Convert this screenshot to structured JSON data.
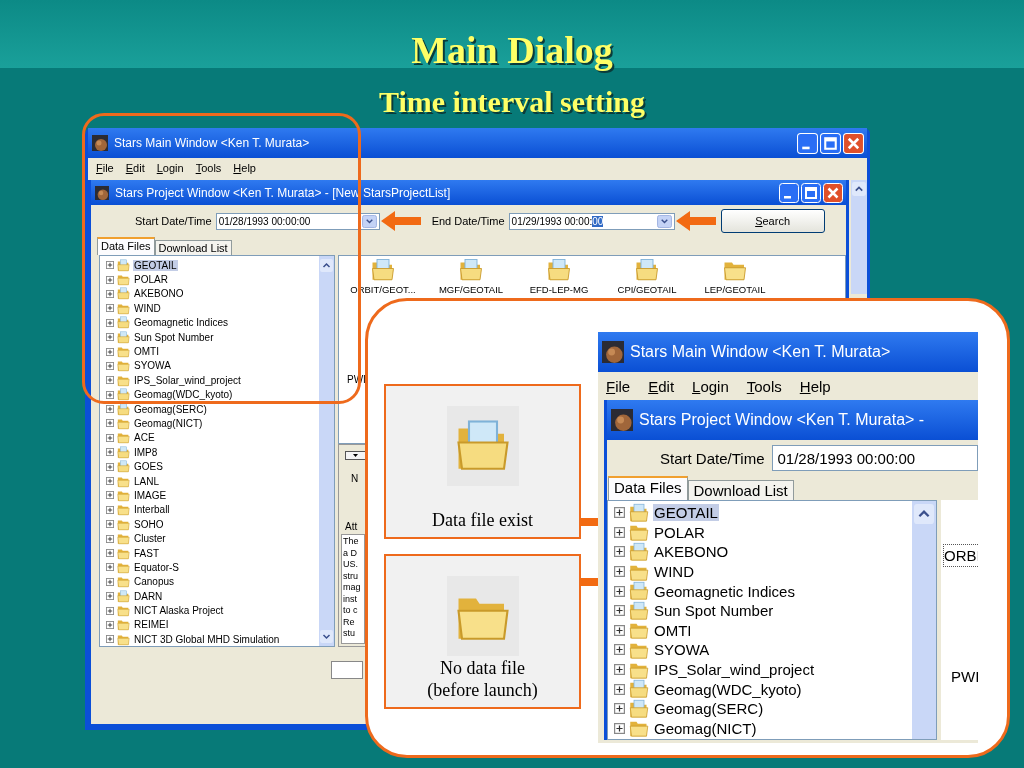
{
  "slide": {
    "title": "Main Dialog",
    "subtitle": "Time interval setting"
  },
  "main_window": {
    "title": "Stars Main Window <Ken T. Murata>",
    "menu": [
      "File",
      "Edit",
      "Login",
      "Tools",
      "Help"
    ],
    "project_window": {
      "title": "Stars Project Window <Ken T. Murata> - [New StarsProjectList]",
      "start_label": "Start Date/Time",
      "start_value": "01/28/1993 00:00:00",
      "end_label": "End Date/Time",
      "end_value": "01/29/1993 00:00:",
      "end_selection": "00",
      "search_button": "Search",
      "tabs": [
        {
          "label": "Data Files",
          "selected": true
        },
        {
          "label": "Download List",
          "selected": false
        }
      ],
      "tree": [
        {
          "name": "GEOTAIL",
          "data": true,
          "selected": true
        },
        {
          "name": "POLAR",
          "data": false,
          "selected": false
        },
        {
          "name": "AKEBONO",
          "data": true,
          "selected": false
        },
        {
          "name": "WIND",
          "data": false,
          "selected": false
        },
        {
          "name": "Geomagnetic Indices",
          "data": true,
          "selected": false
        },
        {
          "name": "Sun Spot Number",
          "data": true,
          "selected": false
        },
        {
          "name": "OMTI",
          "data": false,
          "selected": false
        },
        {
          "name": "SYOWA",
          "data": false,
          "selected": false
        },
        {
          "name": "IPS_Solar_wind_project",
          "data": false,
          "selected": false
        },
        {
          "name": "Geomag(WDC_kyoto)",
          "data": true,
          "selected": false
        },
        {
          "name": "Geomag(SERC)",
          "data": true,
          "selected": false
        },
        {
          "name": "Geomag(NICT)",
          "data": false,
          "selected": false
        },
        {
          "name": "ACE",
          "data": false,
          "selected": false
        },
        {
          "name": "IMP8",
          "data": true,
          "selected": false
        },
        {
          "name": "GOES",
          "data": true,
          "selected": false
        },
        {
          "name": "LANL",
          "data": false,
          "selected": false
        },
        {
          "name": "IMAGE",
          "data": false,
          "selected": false
        },
        {
          "name": "Interball",
          "data": false,
          "selected": false
        },
        {
          "name": "SOHO",
          "data": false,
          "selected": false
        },
        {
          "name": "Cluster",
          "data": false,
          "selected": false
        },
        {
          "name": "FAST",
          "data": false,
          "selected": false
        },
        {
          "name": "Equator-S",
          "data": false,
          "selected": false
        },
        {
          "name": "Canopus",
          "data": false,
          "selected": false
        },
        {
          "name": "DARN",
          "data": true,
          "selected": false
        },
        {
          "name": "NICT Alaska Project",
          "data": false,
          "selected": false
        },
        {
          "name": "REIMEI",
          "data": false,
          "selected": false
        },
        {
          "name": "NICT 3D Global MHD Simulation",
          "data": false,
          "selected": false
        }
      ],
      "files": [
        {
          "name": "ORBIT/GEOT...",
          "data": true
        },
        {
          "name": "MGF/GEOTAIL",
          "data": true
        },
        {
          "name": "EFD-LEP-MG",
          "data": true
        },
        {
          "name": "CPI/GEOTAIL",
          "data": true
        },
        {
          "name": "LEP/GEOTAIL",
          "data": false
        }
      ],
      "second_row_file": "PWI",
      "detail": {
        "name_fragment": "N",
        "attributes_label": "Att",
        "text_lines": [
          "The",
          "a D",
          "US.",
          "stru",
          "mag",
          "inst",
          "to c",
          "Re",
          "stu"
        ]
      }
    }
  },
  "callout": {
    "legend": [
      {
        "kind": "data",
        "lines": [
          "Data file exist"
        ]
      },
      {
        "kind": "empty",
        "lines": [
          "No data file",
          "(before launch)"
        ]
      }
    ],
    "zoom": {
      "main_title": "Stars Main Window <Ken T. Murata>",
      "menu": [
        "File",
        "Edit",
        "Login",
        "Tools",
        "Help"
      ],
      "project_title": "Stars Project Window <Ken T. Murata> -",
      "start_label": "Start Date/Time",
      "start_value": "01/28/1993 00:00:00",
      "tabs": [
        {
          "label": "Data Files",
          "selected": true
        },
        {
          "label": "Download List",
          "selected": false
        }
      ],
      "tree": [
        {
          "name": "GEOTAIL",
          "data": true,
          "selected": true
        },
        {
          "name": "POLAR",
          "data": false,
          "selected": false
        },
        {
          "name": "AKEBONO",
          "data": true,
          "selected": false
        },
        {
          "name": "WIND",
          "data": false,
          "selected": false
        },
        {
          "name": "Geomagnetic Indices",
          "data": true,
          "selected": false
        },
        {
          "name": "Sun Spot Number",
          "data": true,
          "selected": false
        },
        {
          "name": "OMTI",
          "data": false,
          "selected": false
        },
        {
          "name": "SYOWA",
          "data": false,
          "selected": false
        },
        {
          "name": "IPS_Solar_wind_project",
          "data": false,
          "selected": false
        },
        {
          "name": "Geomag(WDC_kyoto)",
          "data": true,
          "selected": false
        },
        {
          "name": "Geomag(SERC)",
          "data": true,
          "selected": false
        },
        {
          "name": "Geomag(NICT)",
          "data": false,
          "selected": false
        }
      ],
      "files": [
        "ORBI",
        "PWI"
      ]
    }
  }
}
